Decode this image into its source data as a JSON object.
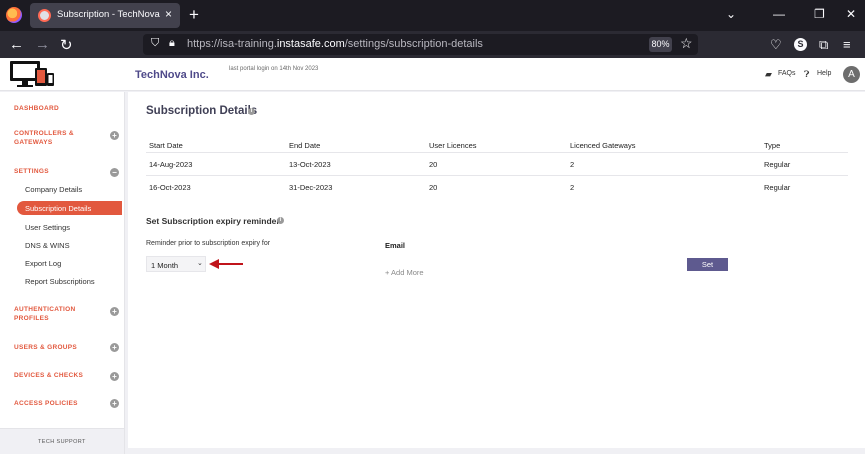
{
  "browser": {
    "tab_title": "Subscription - TechNova Inc. | I",
    "tab_close": "×",
    "new_tab": "+",
    "url_prefix": "https://isa-training.",
    "url_domain": "instasafe.com",
    "url_path": "/settings/subscription-details",
    "zoom": "80%",
    "profile_initial": "S"
  },
  "header": {
    "company": "TechNova Inc.",
    "last_login": "last portal login on 14th Nov 2023",
    "faq_label": "FAQs",
    "help_label": "Help",
    "avatar_initial": "A"
  },
  "sidebar": {
    "dashboard": "DASHBOARD",
    "controllers_l1": "CONTROLLERS &",
    "controllers_l2": "GATEWAYS",
    "settings": "SETTINGS",
    "settings_items": {
      "company_details": "Company Details",
      "subscription_details": "Subscription Details",
      "user_settings": "User Settings",
      "dns_wins": "DNS & WINS",
      "export_log": "Export Log",
      "report_subscriptions": "Report Subscriptions"
    },
    "auth_l1": "AUTHENTICATION",
    "auth_l2": "PROFILES",
    "users_groups": "USERS & GROUPS",
    "devices_checks": "DEVICES & CHECKS",
    "access_policies": "ACCESS POLICIES",
    "tech_support": "TECH SUPPORT",
    "plus": "+",
    "minus": "−"
  },
  "main": {
    "title": "Subscription Details",
    "info_glyph": "i",
    "columns": [
      "Start Date",
      "End Date",
      "User Licences",
      "Licenced Gateways",
      "Type"
    ],
    "rows": [
      [
        "14-Aug-2023",
        "13-Oct-2023",
        "20",
        "2",
        "Regular"
      ],
      [
        "16-Oct-2023",
        "31-Dec-2023",
        "20",
        "2",
        "Regular"
      ]
    ],
    "reminder_title": "Set Subscription expiry reminder",
    "reminder_label": "Reminder prior to subscription expiry for",
    "reminder_value": "1 Month",
    "email_label": "Email",
    "add_more": "+ Add More",
    "set_button": "Set"
  },
  "colors": {
    "accent": "#e2583e",
    "primary": "#5e5a8f",
    "annotation_arrow": "#c0141b"
  }
}
